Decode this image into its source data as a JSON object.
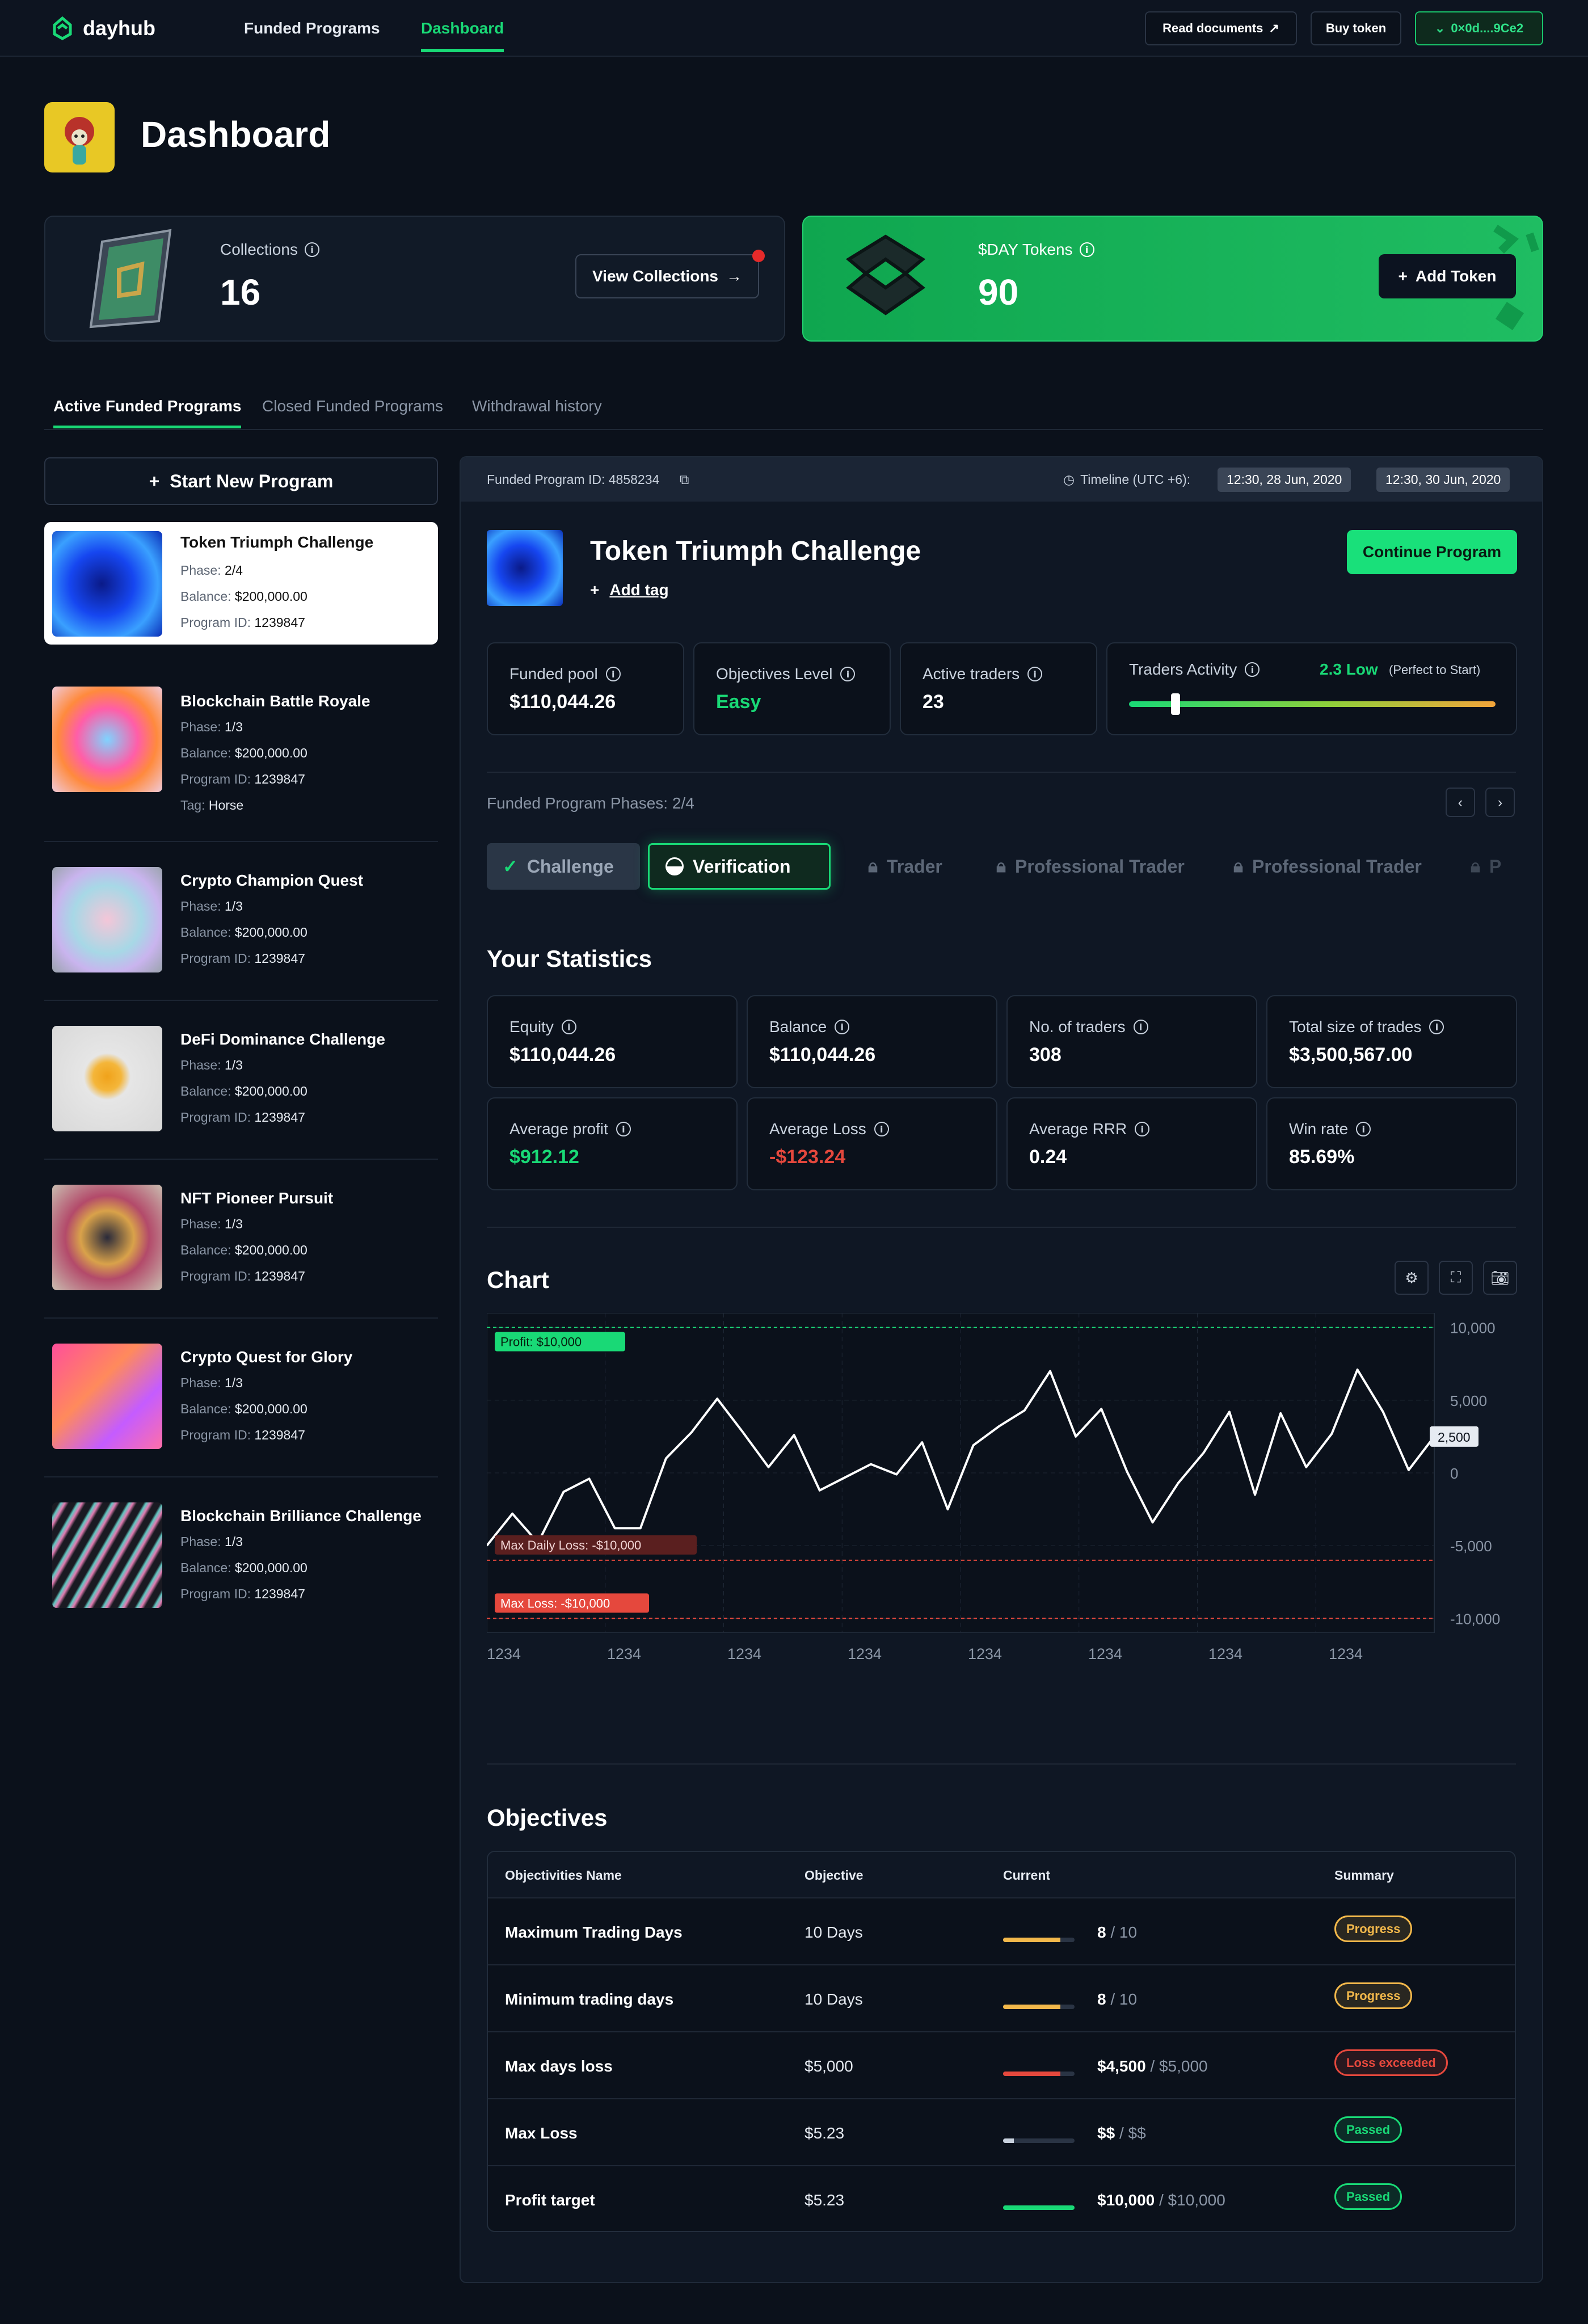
{
  "nav": {
    "brand": "dayhub",
    "links": [
      "Funded Programs",
      "Dashboard"
    ],
    "read_docs": "Read documents",
    "buy_token": "Buy token",
    "wallet": "0×0d....9Ce2"
  },
  "page": {
    "title": "Dashboard"
  },
  "collections": {
    "label": "Collections",
    "value": "16",
    "button": "View Collections"
  },
  "tokens": {
    "label": "$DAY Tokens",
    "value": "90",
    "button": "Add Token"
  },
  "tabs": [
    "Active Funded Programs",
    "Closed Funded Programs",
    "Withdrawal history"
  ],
  "start_program": "Start New Program",
  "programs": [
    {
      "name": "Token Triumph Challenge",
      "phase": "2/4",
      "balance": "$200,000.00",
      "id": "1239847",
      "tag": ""
    },
    {
      "name": "Blockchain Battle Royale",
      "phase": "1/3",
      "balance": "$200,000.00",
      "id": "1239847",
      "tag": "Horse"
    },
    {
      "name": "Crypto Champion Quest",
      "phase": "1/3",
      "balance": "$200,000.00",
      "id": "1239847",
      "tag": ""
    },
    {
      "name": "DeFi Dominance Challenge",
      "phase": "1/3",
      "balance": "$200,000.00",
      "id": "1239847",
      "tag": ""
    },
    {
      "name": "NFT Pioneer Pursuit",
      "phase": "1/3",
      "balance": "$200,000.00",
      "id": "1239847",
      "tag": ""
    },
    {
      "name": "Crypto Quest for Glory",
      "phase": "1/3",
      "balance": "$200,000.00",
      "id": "1239847",
      "tag": ""
    },
    {
      "name": "Blockchain Brilliance Challenge",
      "phase": "1/3",
      "balance": "$200,000.00",
      "id": "1239847",
      "tag": ""
    }
  ],
  "program_labels": {
    "phase": "Phase:",
    "balance": "Balance:",
    "id": "Program ID:",
    "tag": "Tag:"
  },
  "detail": {
    "id_label": "Funded Program ID: 4858234",
    "timeline_label": "Timeline (UTC +6):",
    "start": "12:30, 28 Jun, 2020",
    "end": "12:30, 30 Jun, 2020",
    "title": "Token Triumph Challenge",
    "add_tag": "Add tag",
    "continue": "Continue Program",
    "funded_pool_label": "Funded pool",
    "funded_pool": "$110,044.26",
    "objectives_label": "Objectives Level",
    "objectives": "Easy",
    "traders_label": "Active traders",
    "traders": "23",
    "activity_label": "Traders Activity",
    "activity_value": "2.3 Low",
    "activity_note": "(Perfect to Start)",
    "phases_label": "Funded Program Phases: 2/4",
    "phases": [
      "Challenge",
      "Verification",
      "Trader",
      "Professional Trader",
      "Professional Trader",
      "P"
    ]
  },
  "stats_title": "Your Statistics",
  "stats": [
    {
      "label": "Equity",
      "value": "$110,044.26"
    },
    {
      "label": "Balance",
      "value": "$110,044.26"
    },
    {
      "label": "No. of traders",
      "value": "308"
    },
    {
      "label": "Total size of trades",
      "value": "$3,500,567.00"
    },
    {
      "label": "Average profit",
      "value": "$912.12"
    },
    {
      "label": "Average Loss",
      "value": "-$123.24"
    },
    {
      "label": "Average RRR",
      "value": "0.24"
    },
    {
      "label": "Win rate",
      "value": "85.69%"
    }
  ],
  "chart_title": "Chart",
  "chart_data": {
    "type": "line",
    "x_tick_labels": [
      "1234",
      "1234",
      "1234",
      "1234",
      "1234",
      "1234",
      "1234",
      "1234"
    ],
    "y_tick_labels": [
      "10,000",
      "5,000",
      "0",
      "-5,000",
      "-10,000"
    ],
    "ylim": [
      -11000,
      11000
    ],
    "current_label": "2,500",
    "profit_label": "Profit: $10,000",
    "profit_level": 10000,
    "daily_loss_label": "Max Daily Loss: -$10,000",
    "daily_loss_level": -6000,
    "max_loss_label": "Max Loss: -$10,000",
    "max_loss_level": -10000,
    "values": [
      -5000,
      -2800,
      -4800,
      -1300,
      -400,
      -3800,
      -3800,
      1000,
      2800,
      5100,
      2800,
      400,
      2600,
      -1200,
      -300,
      600,
      -100,
      2100,
      -2500,
      1900,
      3200,
      4300,
      7000,
      2500,
      4400,
      100,
      -3400,
      -700,
      1400,
      4200,
      -1500,
      4100,
      400,
      2700,
      7100,
      4200,
      200,
      2500
    ]
  },
  "objectives_title": "Objectives",
  "objectives_head": [
    "Objectivities Name",
    "Objective",
    "Current",
    "Summary"
  ],
  "objectives": [
    {
      "name": "Maximum Trading Days",
      "objective": "10 Days",
      "current": "8",
      "total": "/ 10",
      "progress": 0.8,
      "color": "#f2b84b",
      "status": "Progress",
      "scolor": "#f2b84b"
    },
    {
      "name": "Minimum trading days",
      "objective": "10 Days",
      "current": "8",
      "total": "/ 10",
      "progress": 0.8,
      "color": "#f2b84b",
      "status": "Progress",
      "scolor": "#f2b84b"
    },
    {
      "name": "Max days loss",
      "objective": "$5,000",
      "current": "$4,500",
      "total": "/ $5,000",
      "progress": 0.8,
      "color": "#e5483d",
      "status": "Loss exceeded",
      "scolor": "#e5483d"
    },
    {
      "name": "Max Loss",
      "objective": "$5.23",
      "current": "$$",
      "total": "/ $$",
      "progress": 0.15,
      "color": "#c9d2de",
      "status": "Passed",
      "scolor": "#19d976"
    },
    {
      "name": "Profit target",
      "objective": "$5.23",
      "current": "$10,000",
      "total": "/ $10,000",
      "progress": 1,
      "color": "#19d976",
      "status": "Passed",
      "scolor": "#19d976"
    }
  ]
}
